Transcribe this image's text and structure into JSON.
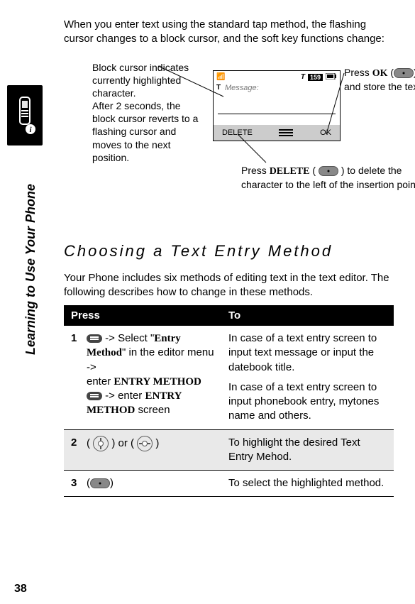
{
  "page_number": "38",
  "side_label": "Learning to Use Your Phone",
  "intro_text": "When you enter text using the standard tap method, the flashing cursor changes to a block cursor, and the soft key functions change:",
  "diagram": {
    "callout_block_cursor": "Block cursor indicates currently highlighted character.\nAfter 2 seconds, the block cursor reverts to a flashing cursor and moves to the next position.",
    "callout_ok_prefix": "Press ",
    "callout_ok_key": "OK",
    "callout_ok_suffix": " to accept and store the text.",
    "callout_delete_prefix": "Press ",
    "callout_delete_key": "DELETE",
    "callout_delete_suffix": " to delete the character to the left of the insertion point.",
    "screen": {
      "badge": "159",
      "message_label": "Message:",
      "soft_left": "DELETE",
      "soft_right": "OK"
    }
  },
  "section_heading": "Choosing a Text Entry Method",
  "section_intro": "Your Phone includes six methods of editing text in the text editor. The following describes how to change in these methods.",
  "table": {
    "head_press": "Press",
    "head_to": "To",
    "rows": [
      {
        "num": "1",
        "press_a": " -> Select \"",
        "press_b_serif": "Entry Method",
        "press_c": "\" in the editor menu ->",
        "press_d": "enter ",
        "press_e_serif": "ENTRY METHOD",
        "press_f": " -> enter ",
        "press_g_serif": "ENTRY METHOD",
        "press_h": " screen",
        "to1": "In case of a text entry screen to input text message or input the datebook title.",
        "to2": "In case of a text entry screen to input phonebook entry, mytones name and others."
      },
      {
        "num": "2",
        "press_sep": " or ",
        "to": "To highlight the desired Text Entry Mehod."
      },
      {
        "num": "3",
        "to": "To select the highlighted method."
      }
    ]
  }
}
